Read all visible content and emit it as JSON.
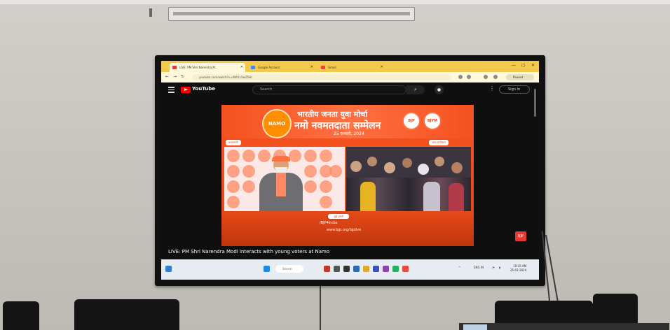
{
  "browser": {
    "tabs": [
      {
        "label": "LIVE: PM Shri Narendra M...",
        "active": true
      },
      {
        "label": "Google Account",
        "active": false
      },
      {
        "label": "Gmail",
        "active": false
      }
    ],
    "url": "youtube.com/watch?v=KWr1cSwZ5Hc",
    "profile_label": "Paused"
  },
  "youtube": {
    "logo_text": "YouTube",
    "search_placeholder": "Search",
    "sign_in_label": "Sign in",
    "video_title": "LIVE: PM Shri Narendra Modi interacts with young voters at Namo"
  },
  "video_frame": {
    "logo_text": "NAMO",
    "title_line1": "भारतीय जनता युवा मोर्चा",
    "title_line2": "नमो नवमतदाता सम्मेलन",
    "date_text": "25 जनवरी, 2024",
    "left_label": "प्रधानमंत्री",
    "right_label": "अन्य कार्यक्रम",
    "badge_left": "BJP",
    "badge_right": "BJYM",
    "handle_text": "जुड़ें हमसे",
    "social_text": "/BJP4India",
    "site_text": "www.bjp.org/bjplive"
  },
  "taskbar": {
    "search_text": "Search",
    "tray_text": "ENG IN",
    "time": "10:15 AM",
    "date": "25-01-2024"
  },
  "colors": {
    "tab_strip": "#f2c94c",
    "youtube_red": "#ff0000",
    "saffron": "#f4511e"
  }
}
